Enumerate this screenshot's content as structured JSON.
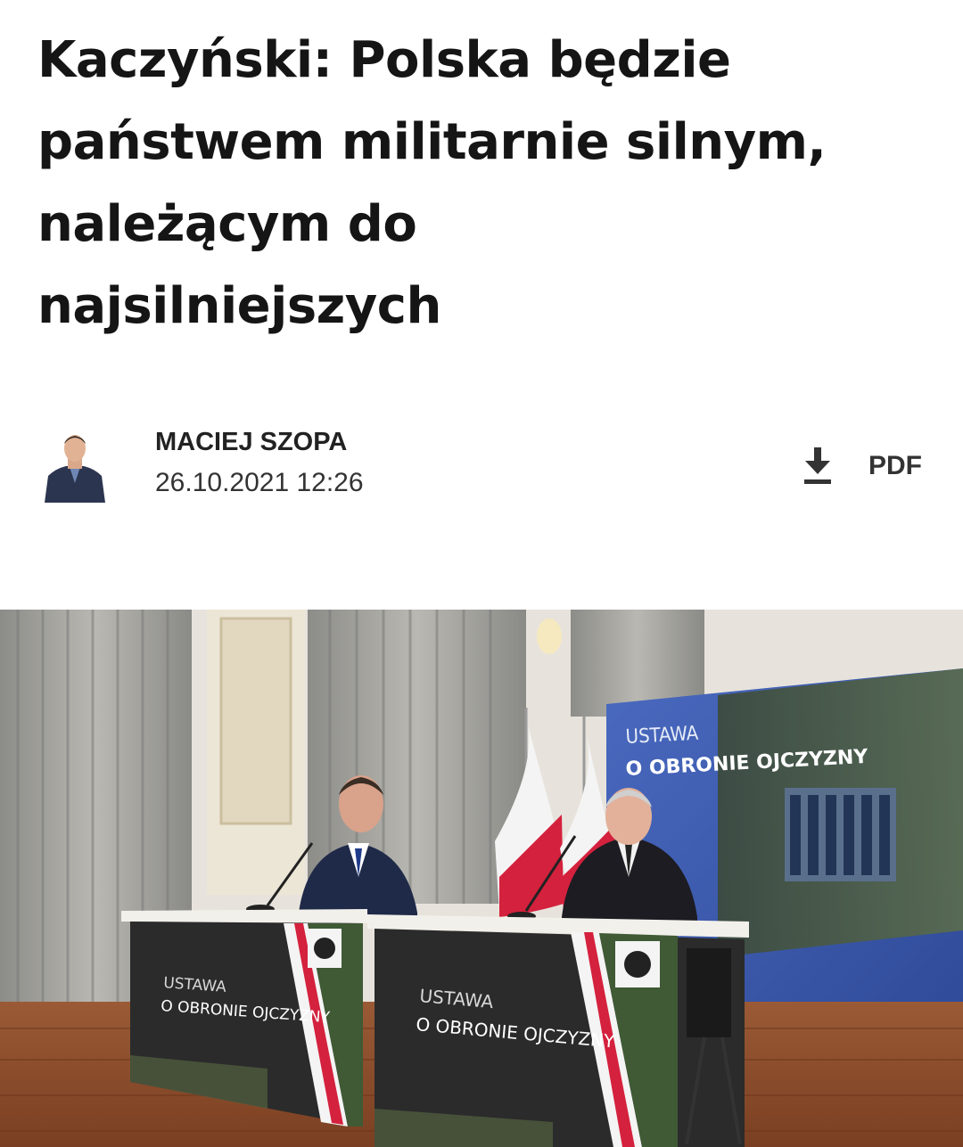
{
  "article": {
    "title_lines": [
      "Kaczyński: Polska będzie",
      "państwem militarnie silnym,",
      "należącym do",
      "najsilniejszych"
    ],
    "author": "MACIEJ SZOPA",
    "date": "26.10.2021 12:26",
    "pdf_label": "PDF"
  },
  "icons": {
    "download": "download-icon"
  },
  "photo": {
    "screen_text_line1": "USTAWA",
    "screen_text_line2": "O OBRONIE OJCZYZNY",
    "desk_text_line1": "USTAWA",
    "desk_text_line2": "O OBRONIE OJCZYZNY"
  },
  "colors": {
    "text": "#151515",
    "flag_red": "#d4213d",
    "screen_blue": "#3f5fb0"
  }
}
